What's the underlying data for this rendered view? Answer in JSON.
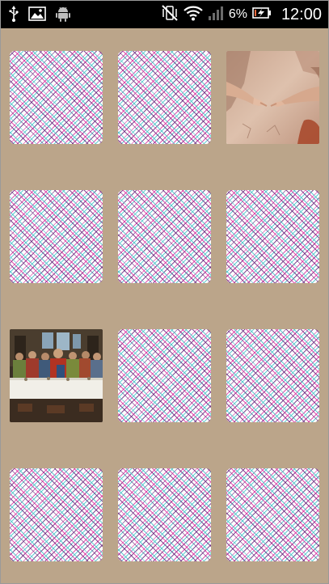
{
  "status_bar": {
    "battery_percent": "6%",
    "time": "12:00",
    "left_icons": [
      "usb-icon",
      "gallery-icon",
      "android-icon"
    ],
    "right_icons": [
      "vibrate-icon",
      "wifi-icon",
      "signal-icon",
      "battery-charging-icon"
    ]
  },
  "board": {
    "rows": 4,
    "columns": 3,
    "background_color": "#bba58a",
    "card_back_colors": [
      "#6f2d82",
      "#d62c9c",
      "#54c6cc"
    ],
    "cards": [
      {
        "state": "face-down"
      },
      {
        "state": "face-down"
      },
      {
        "state": "face-up",
        "image": "creation-of-adam-hands"
      },
      {
        "state": "face-down"
      },
      {
        "state": "face-down"
      },
      {
        "state": "face-down"
      },
      {
        "state": "face-up",
        "image": "last-supper"
      },
      {
        "state": "face-down"
      },
      {
        "state": "face-down"
      },
      {
        "state": "face-down"
      },
      {
        "state": "face-down"
      },
      {
        "state": "face-down"
      }
    ]
  }
}
